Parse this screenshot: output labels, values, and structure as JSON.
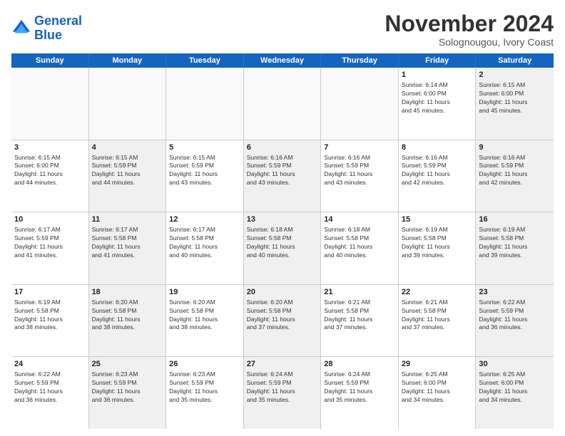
{
  "header": {
    "logo_line1": "General",
    "logo_line2": "Blue",
    "month": "November 2024",
    "location": "Solognougou, Ivory Coast"
  },
  "days_of_week": [
    "Sunday",
    "Monday",
    "Tuesday",
    "Wednesday",
    "Thursday",
    "Friday",
    "Saturday"
  ],
  "rows": [
    [
      {
        "day": "",
        "info": "",
        "empty": true
      },
      {
        "day": "",
        "info": "",
        "empty": true
      },
      {
        "day": "",
        "info": "",
        "empty": true
      },
      {
        "day": "",
        "info": "",
        "empty": true
      },
      {
        "day": "",
        "info": "",
        "empty": true
      },
      {
        "day": "1",
        "info": "Sunrise: 6:14 AM\nSunset: 6:00 PM\nDaylight: 11 hours\nand 45 minutes.",
        "shaded": false
      },
      {
        "day": "2",
        "info": "Sunrise: 6:15 AM\nSunset: 6:00 PM\nDaylight: 11 hours\nand 45 minutes.",
        "shaded": true
      }
    ],
    [
      {
        "day": "3",
        "info": "Sunrise: 6:15 AM\nSunset: 6:00 PM\nDaylight: 11 hours\nand 44 minutes.",
        "shaded": false
      },
      {
        "day": "4",
        "info": "Sunrise: 6:15 AM\nSunset: 5:59 PM\nDaylight: 11 hours\nand 44 minutes.",
        "shaded": true
      },
      {
        "day": "5",
        "info": "Sunrise: 6:15 AM\nSunset: 5:59 PM\nDaylight: 11 hours\nand 43 minutes.",
        "shaded": false
      },
      {
        "day": "6",
        "info": "Sunrise: 6:16 AM\nSunset: 5:59 PM\nDaylight: 11 hours\nand 43 minutes.",
        "shaded": true
      },
      {
        "day": "7",
        "info": "Sunrise: 6:16 AM\nSunset: 5:59 PM\nDaylight: 11 hours\nand 43 minutes.",
        "shaded": false
      },
      {
        "day": "8",
        "info": "Sunrise: 6:16 AM\nSunset: 5:59 PM\nDaylight: 11 hours\nand 42 minutes.",
        "shaded": false
      },
      {
        "day": "9",
        "info": "Sunrise: 6:16 AM\nSunset: 5:59 PM\nDaylight: 11 hours\nand 42 minutes.",
        "shaded": true
      }
    ],
    [
      {
        "day": "10",
        "info": "Sunrise: 6:17 AM\nSunset: 5:59 PM\nDaylight: 11 hours\nand 41 minutes.",
        "shaded": false
      },
      {
        "day": "11",
        "info": "Sunrise: 6:17 AM\nSunset: 5:58 PM\nDaylight: 11 hours\nand 41 minutes.",
        "shaded": true
      },
      {
        "day": "12",
        "info": "Sunrise: 6:17 AM\nSunset: 5:58 PM\nDaylight: 11 hours\nand 40 minutes.",
        "shaded": false
      },
      {
        "day": "13",
        "info": "Sunrise: 6:18 AM\nSunset: 5:58 PM\nDaylight: 11 hours\nand 40 minutes.",
        "shaded": true
      },
      {
        "day": "14",
        "info": "Sunrise: 6:18 AM\nSunset: 5:58 PM\nDaylight: 11 hours\nand 40 minutes.",
        "shaded": false
      },
      {
        "day": "15",
        "info": "Sunrise: 6:19 AM\nSunset: 5:58 PM\nDaylight: 11 hours\nand 39 minutes.",
        "shaded": false
      },
      {
        "day": "16",
        "info": "Sunrise: 6:19 AM\nSunset: 5:58 PM\nDaylight: 11 hours\nand 39 minutes.",
        "shaded": true
      }
    ],
    [
      {
        "day": "17",
        "info": "Sunrise: 6:19 AM\nSunset: 5:58 PM\nDaylight: 11 hours\nand 38 minutes.",
        "shaded": false
      },
      {
        "day": "18",
        "info": "Sunrise: 6:20 AM\nSunset: 5:58 PM\nDaylight: 11 hours\nand 38 minutes.",
        "shaded": true
      },
      {
        "day": "19",
        "info": "Sunrise: 6:20 AM\nSunset: 5:58 PM\nDaylight: 11 hours\nand 38 minutes.",
        "shaded": false
      },
      {
        "day": "20",
        "info": "Sunrise: 6:20 AM\nSunset: 5:58 PM\nDaylight: 11 hours\nand 37 minutes.",
        "shaded": true
      },
      {
        "day": "21",
        "info": "Sunrise: 6:21 AM\nSunset: 5:58 PM\nDaylight: 11 hours\nand 37 minutes.",
        "shaded": false
      },
      {
        "day": "22",
        "info": "Sunrise: 6:21 AM\nSunset: 5:58 PM\nDaylight: 11 hours\nand 37 minutes.",
        "shaded": false
      },
      {
        "day": "23",
        "info": "Sunrise: 6:22 AM\nSunset: 5:59 PM\nDaylight: 11 hours\nand 36 minutes.",
        "shaded": true
      }
    ],
    [
      {
        "day": "24",
        "info": "Sunrise: 6:22 AM\nSunset: 5:59 PM\nDaylight: 11 hours\nand 36 minutes.",
        "shaded": false
      },
      {
        "day": "25",
        "info": "Sunrise: 6:23 AM\nSunset: 5:59 PM\nDaylight: 11 hours\nand 36 minutes.",
        "shaded": true
      },
      {
        "day": "26",
        "info": "Sunrise: 6:23 AM\nSunset: 5:59 PM\nDaylight: 11 hours\nand 35 minutes.",
        "shaded": false
      },
      {
        "day": "27",
        "info": "Sunrise: 6:24 AM\nSunset: 5:59 PM\nDaylight: 11 hours\nand 35 minutes.",
        "shaded": true
      },
      {
        "day": "28",
        "info": "Sunrise: 6:24 AM\nSunset: 5:59 PM\nDaylight: 11 hours\nand 35 minutes.",
        "shaded": false
      },
      {
        "day": "29",
        "info": "Sunrise: 6:25 AM\nSunset: 6:00 PM\nDaylight: 11 hours\nand 34 minutes.",
        "shaded": false
      },
      {
        "day": "30",
        "info": "Sunrise: 6:25 AM\nSunset: 6:00 PM\nDaylight: 11 hours\nand 34 minutes.",
        "shaded": true
      }
    ]
  ]
}
